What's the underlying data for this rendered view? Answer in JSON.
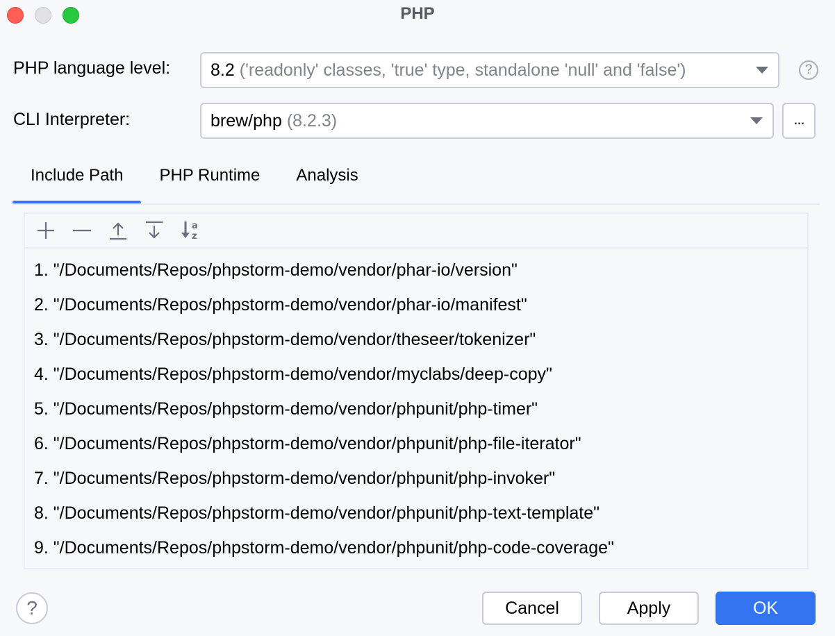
{
  "window": {
    "title": "PHP",
    "controls": [
      "close",
      "minimize",
      "maximize"
    ]
  },
  "form": {
    "language_level": {
      "label": "PHP language level:",
      "value": "8.2",
      "description": "('readonly' classes, 'true' type, standalone 'null' and 'false')"
    },
    "cli_interpreter": {
      "label": "CLI Interpreter:",
      "value": "brew/php",
      "description": "(8.2.3)",
      "browse_label": "..."
    }
  },
  "tabs": [
    {
      "label": "Include Path",
      "active": true
    },
    {
      "label": "PHP Runtime",
      "active": false
    },
    {
      "label": "Analysis",
      "active": false
    }
  ],
  "toolbar": {
    "icons": [
      "add-icon",
      "remove-icon",
      "move-up-icon",
      "move-down-icon",
      "sort-alphabetically-icon"
    ]
  },
  "include_paths": [
    "1. \"/Documents/Repos/phpstorm-demo/vendor/phar-io/version\"",
    "2. \"/Documents/Repos/phpstorm-demo/vendor/phar-io/manifest\"",
    "3. \"/Documents/Repos/phpstorm-demo/vendor/theseer/tokenizer\"",
    "4. \"/Documents/Repos/phpstorm-demo/vendor/myclabs/deep-copy\"",
    "5. \"/Documents/Repos/phpstorm-demo/vendor/phpunit/php-timer\"",
    "6. \"/Documents/Repos/phpstorm-demo/vendor/phpunit/php-file-iterator\"",
    "7. \"/Documents/Repos/phpstorm-demo/vendor/phpunit/php-invoker\"",
    "8. \"/Documents/Repos/phpstorm-demo/vendor/phpunit/php-text-template\"",
    "9. \"/Documents/Repos/phpstorm-demo/vendor/phpunit/php-code-coverage\""
  ],
  "footer": {
    "help_label": "?",
    "cancel_label": "Cancel",
    "apply_label": "Apply",
    "ok_label": "OK"
  },
  "colors": {
    "accent": "#3574f0",
    "background": "#f7f8fa",
    "border": "#c9ccd6",
    "secondary_text": "#80848b"
  }
}
